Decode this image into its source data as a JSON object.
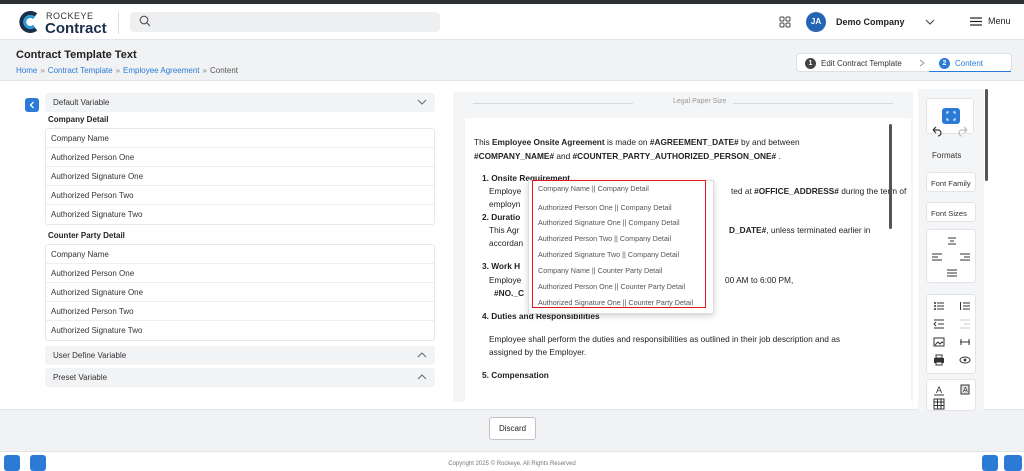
{
  "header": {
    "logo_small": "ROCKEYE",
    "logo_big": "Contract",
    "avatar_initials": "JA",
    "company": "Demo Company",
    "menu_label": "Menu"
  },
  "page": {
    "title": "Contract Template Text",
    "breadcrumb": [
      "Home",
      "Contract Template",
      "Employee Agreement",
      "Content"
    ],
    "breadcrumb_sep": "»"
  },
  "stepper": {
    "steps": [
      {
        "num": "1",
        "label": "Edit Contract Template"
      },
      {
        "num": "2",
        "label": "Content"
      }
    ]
  },
  "variables": {
    "default_label": "Default Variable",
    "company_group": "Company Detail",
    "company_items": [
      "Company Name",
      "Authorized Person One",
      "Authorized Signature One",
      "Authorized Person Two",
      "Authorized Signature Two"
    ],
    "counter_group": "Counter Party Detail",
    "counter_items": [
      "Company Name",
      "Authorized Person One",
      "Authorized Signature One",
      "Authorized Person Two",
      "Authorized Signature Two"
    ],
    "user_define_label": "User Define Variable",
    "preset_label": "Preset Variable"
  },
  "editor": {
    "paper_label": "Legal Paper Size",
    "intro_1": "This ",
    "intro_bold": "Employee Onsite Agreement",
    "intro_2": " is made on ",
    "intro_var1": "#AGREEMENT_DATE#",
    "intro_3": "  by and between",
    "intro_var2": "#COMPANY_NAME#",
    "intro_4": " and  ",
    "intro_var3": "#COUNTER_PARTY_AUTHORIZED_PERSON_ONE#",
    "intro_5": " .",
    "s1_title": "1. Onsite Requirement",
    "s1_a_pre": "Employe",
    "s1_a_post": "ted at  ",
    "s1_a_var": "#OFFICE_ADDRESS#",
    "s1_a_end": " during the term of",
    "s1_b": "employn",
    "s2_title": "2. Duratio",
    "s2_a_pre": "This Agr",
    "s2_a_var": "D_DATE#",
    "s2_a_end": ", unless terminated earlier in",
    "s2_b": "accordan",
    "s3_title": "3. Work H",
    "s3_a_pre": "Employe",
    "s3_a_end": "00 AM to 6:00 PM,",
    "s3_b": "#NO._C",
    "s4_title": "4. Duties and Responsibilities",
    "s4_a": "Employee shall perform the duties and responsibilities as outlined in their job description and as",
    "s4_b": "assigned by the Employer.",
    "s5_title": "5. Compensation"
  },
  "dropdown": {
    "items": [
      "Company Name || Company Detail",
      "Authorized Person One || Company Detail",
      "Authorized Signature One || Company Detail",
      "Authorized Person Two || Company Detail",
      "Authorized Signature Two || Company Detail",
      "Company Name || Counter Party Detail",
      "Authorized Person One || Counter Party Detail",
      "Authorized Signature One || Counter Party Detail"
    ],
    "highlight_color": "#e0181e"
  },
  "toolbar": {
    "formats": "Formats",
    "font_family": "Font Family",
    "font_sizes": "Font Sizes"
  },
  "footer": {
    "discard": "Discard",
    "copyright": "Copyright 2025 © Rockeye. All Rights Reserved"
  },
  "colors": {
    "accent": "#2b7bd6",
    "brand_dark": "#1b2e4a"
  }
}
